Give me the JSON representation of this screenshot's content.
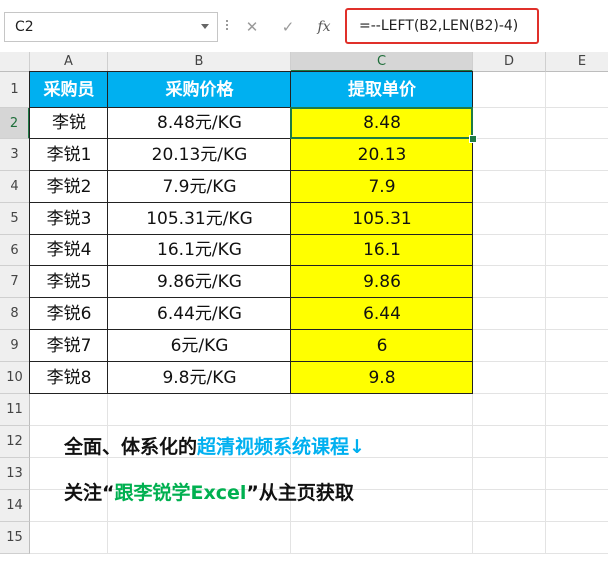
{
  "name_box": {
    "value": "C2"
  },
  "formula_bar": {
    "fx_label": "fx",
    "formula": "=--LEFT(B2,LEN(B2)-4)"
  },
  "columns": [
    "A",
    "B",
    "C",
    "D",
    "E"
  ],
  "rows": [
    "1",
    "2",
    "3",
    "4",
    "5",
    "6",
    "7",
    "8",
    "9",
    "10",
    "11",
    "12",
    "13",
    "14",
    "15"
  ],
  "table": {
    "headers": [
      "采购员",
      "采购价格",
      "提取单价"
    ],
    "data": [
      [
        "李锐",
        "8.48元/KG",
        "8.48"
      ],
      [
        "李锐1",
        "20.13元/KG",
        "20.13"
      ],
      [
        "李锐2",
        "7.9元/KG",
        "7.9"
      ],
      [
        "李锐3",
        "105.31元/KG",
        "105.31"
      ],
      [
        "李锐4",
        "16.1元/KG",
        "16.1"
      ],
      [
        "李锐5",
        "9.86元/KG",
        "9.86"
      ],
      [
        "李锐6",
        "6.44元/KG",
        "6.44"
      ],
      [
        "李锐7",
        "6元/KG",
        "6"
      ],
      [
        "李锐8",
        "9.8元/KG",
        "9.8"
      ]
    ]
  },
  "notes": {
    "line1_a": "全面、体系化的",
    "line1_b": "超清视频系统课程↓",
    "line2_a": "关注“",
    "line2_b": "跟李锐学Excel",
    "line2_c": "”从主页获取"
  },
  "colors": {
    "header_fill": "#00b0f0",
    "highlight_fill": "#ffff00",
    "selection": "#1e7b45",
    "formula_outline": "#e0302a"
  }
}
